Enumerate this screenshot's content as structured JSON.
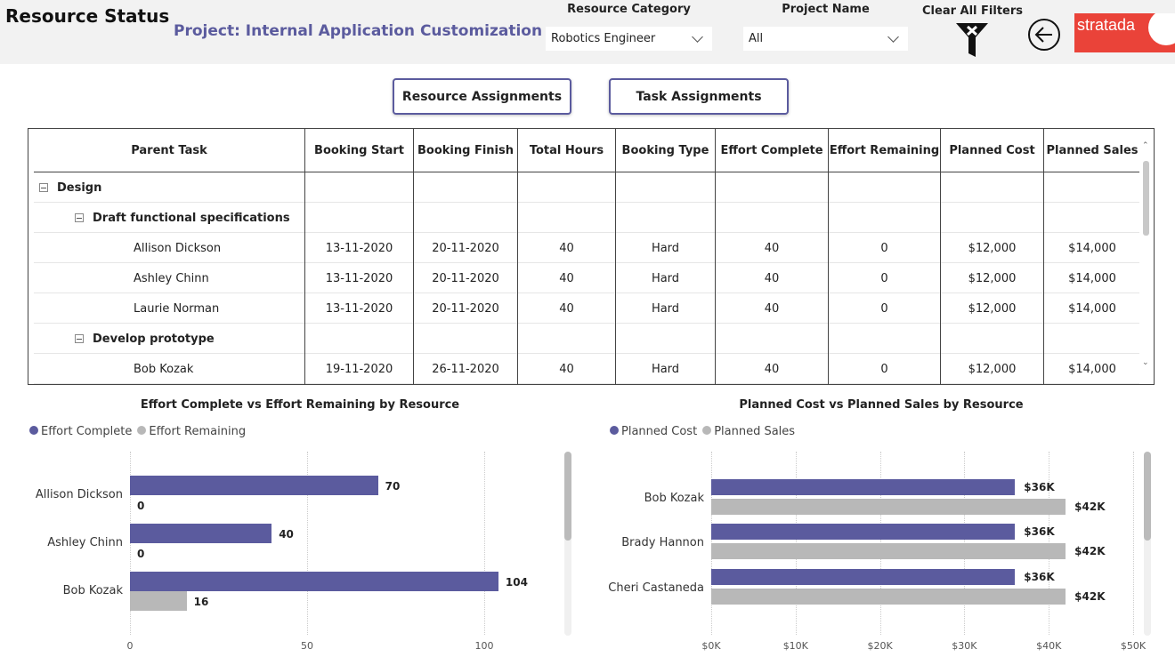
{
  "header": {
    "title": "Resource Status",
    "subtitle": "Project: Internal Application Customization",
    "resource_category": {
      "label": "Resource Category",
      "value": "Robotics Engineer"
    },
    "project_name": {
      "label": "Project Name",
      "value": "All"
    },
    "clear_filters": "Clear All Filters",
    "logo": "stratada"
  },
  "tabs": {
    "resource": "Resource Assignments",
    "task": "Task Assignments"
  },
  "table": {
    "columns": [
      "Parent Task",
      "Booking Start",
      "Booking Finish",
      "Total Hours",
      "Booking Type",
      "Effort Complete",
      "Effort Remaining",
      "Planned Cost",
      "Planned Sales"
    ],
    "rows": [
      {
        "level": 0,
        "name": "Design",
        "values": [
          "",
          "",
          "",
          "",
          "",
          "",
          "",
          ""
        ]
      },
      {
        "level": 1,
        "name": "Draft functional specifications",
        "values": [
          "",
          "",
          "",
          "",
          "",
          "",
          "",
          ""
        ]
      },
      {
        "level": 2,
        "name": "Allison Dickson",
        "values": [
          "13-11-2020",
          "20-11-2020",
          "40",
          "Hard",
          "40",
          "0",
          "$12,000",
          "$14,000"
        ]
      },
      {
        "level": 2,
        "name": "Ashley Chinn",
        "values": [
          "13-11-2020",
          "20-11-2020",
          "40",
          "Hard",
          "40",
          "0",
          "$12,000",
          "$14,000"
        ]
      },
      {
        "level": 2,
        "name": "Laurie Norman",
        "values": [
          "13-11-2020",
          "20-11-2020",
          "40",
          "Hard",
          "40",
          "0",
          "$12,000",
          "$14,000"
        ]
      },
      {
        "level": 1,
        "name": "Develop prototype",
        "values": [
          "",
          "",
          "",
          "",
          "",
          "",
          "",
          ""
        ]
      },
      {
        "level": 2,
        "name": "Bob Kozak",
        "values": [
          "19-11-2020",
          "26-11-2020",
          "40",
          "Hard",
          "40",
          "0",
          "$12,000",
          "$14,000"
        ]
      }
    ]
  },
  "chart_data": [
    {
      "type": "bar",
      "orientation": "horizontal",
      "title": "Effort Complete vs Effort Remaining by Resource",
      "categories": [
        "Allison Dickson",
        "Ashley Chinn",
        "Bob Kozak"
      ],
      "series": [
        {
          "name": "Effort Complete",
          "color": "#5b5b9e",
          "values": [
            70,
            40,
            104
          ],
          "labels": [
            "70",
            "40",
            "104"
          ]
        },
        {
          "name": "Effort Remaining",
          "color": "#b8b8b8",
          "values": [
            0,
            0,
            16
          ],
          "labels": [
            "0",
            "0",
            "16"
          ]
        }
      ],
      "xticks": [
        "0",
        "50",
        "100"
      ],
      "xtick_values": [
        0,
        50,
        100
      ],
      "xlim": [
        0,
        100
      ],
      "grid": true,
      "legend": "top-left"
    },
    {
      "type": "bar",
      "orientation": "horizontal",
      "title": "Planned Cost vs Planned Sales by Resource",
      "categories": [
        "Bob Kozak",
        "Brady Hannon",
        "Cheri Castaneda"
      ],
      "series": [
        {
          "name": "Planned Cost",
          "color": "#5b5b9e",
          "values": [
            36000,
            36000,
            36000
          ],
          "labels": [
            "$36K",
            "$36K",
            "$36K"
          ]
        },
        {
          "name": "Planned Sales",
          "color": "#b8b8b8",
          "values": [
            42000,
            42000,
            42000
          ],
          "labels": [
            "$42K",
            "$42K",
            "$42K"
          ]
        }
      ],
      "xticks": [
        "$0K",
        "$10K",
        "$20K",
        "$30K",
        "$40K",
        "$50K"
      ],
      "xtick_values": [
        0,
        10000,
        20000,
        30000,
        40000,
        50000
      ],
      "xlim": [
        0,
        50000
      ],
      "grid": true,
      "legend": "top-left"
    }
  ]
}
